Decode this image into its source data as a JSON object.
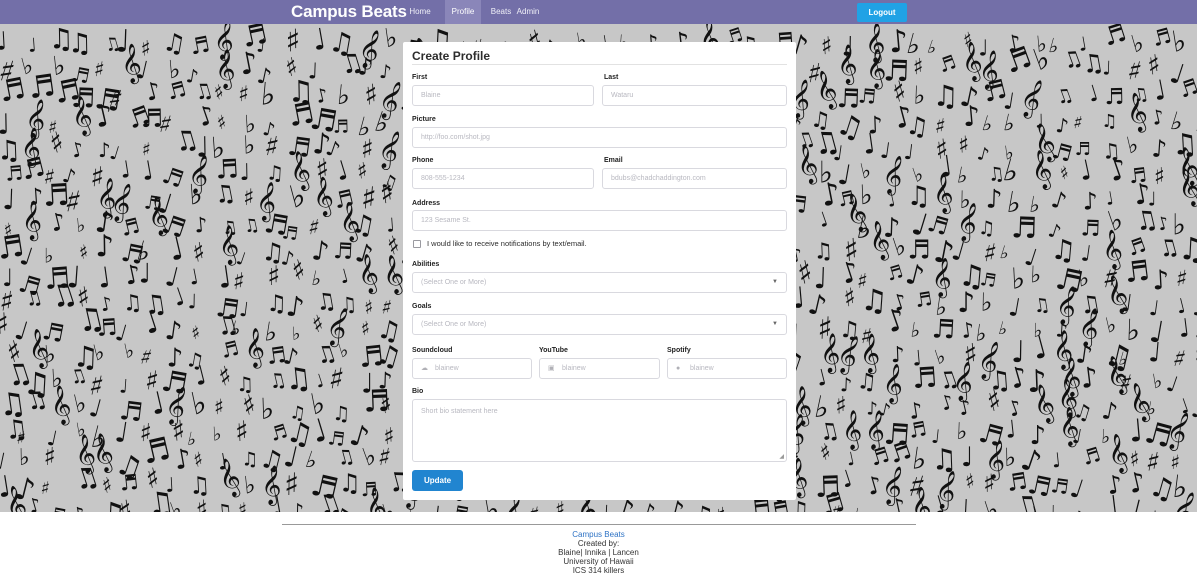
{
  "nav": {
    "brand": "Campus Beats",
    "items": [
      {
        "label": "Home"
      },
      {
        "label": "Profile",
        "active": true
      },
      {
        "label": "Beats"
      },
      {
        "label": "Admin"
      }
    ],
    "logout_label": "Logout",
    "bar_color": "#736fa8",
    "logout_color": "#20a2e5"
  },
  "form": {
    "title": "Create Profile",
    "first": {
      "label": "First",
      "placeholder": "Blaine"
    },
    "last": {
      "label": "Last",
      "placeholder": "Wataru"
    },
    "picture": {
      "label": "Picture",
      "placeholder": "http://foo.com/shot.jpg"
    },
    "phone": {
      "label": "Phone",
      "placeholder": "808-555-1234"
    },
    "email": {
      "label": "Email",
      "placeholder": "bdubs@chadchaddington.com"
    },
    "address": {
      "label": "Address",
      "placeholder": "123 Sesame St."
    },
    "notify_label": "I would like to receive notifications by text/email.",
    "notify_checked": false,
    "abilities": {
      "label": "Abilities",
      "placeholder": "(Select One or More)"
    },
    "goals": {
      "label": "Goals",
      "placeholder": "(Select One or More)"
    },
    "soundcloud": {
      "label": "Soundcloud",
      "placeholder": "blainew",
      "icon": "soundcloud-icon"
    },
    "youtube": {
      "label": "YouTube",
      "placeholder": "blainew",
      "icon": "youtube-icon"
    },
    "spotify": {
      "label": "Spotify",
      "placeholder": "blainew",
      "icon": "spotify-icon"
    },
    "bio": {
      "label": "Bio",
      "placeholder": "Short bio statement here"
    },
    "update_label": "Update",
    "update_color": "#2185d0"
  },
  "footer": {
    "link": "Campus Beats",
    "lines": [
      "Created by:",
      "Blaine| Innika | Lancen",
      "University of Hawaii",
      "ICS 314 killers"
    ]
  }
}
